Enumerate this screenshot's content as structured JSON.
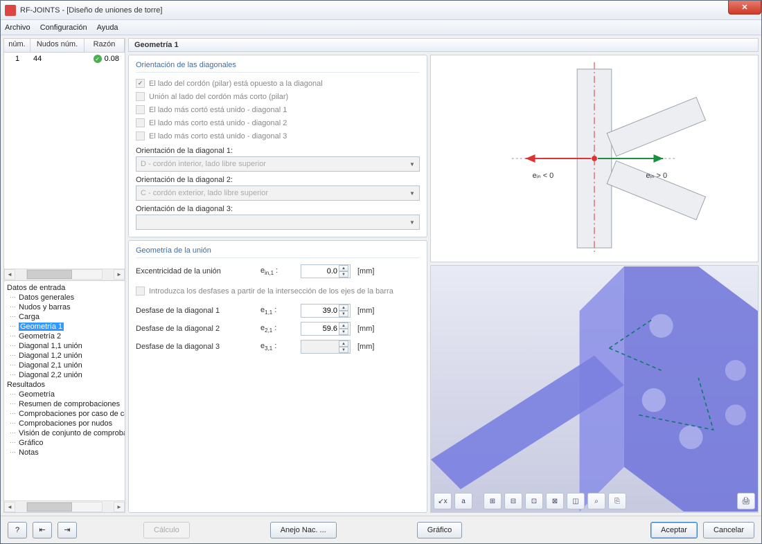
{
  "window": {
    "title": "RF-JOINTS - [Diseño de uniones de torre]",
    "close": "✕"
  },
  "menu": {
    "file": "Archivo",
    "config": "Configuración",
    "help": "Ayuda"
  },
  "grid": {
    "headers": {
      "num": "núm.",
      "nodes": "Nudos núm.",
      "reason": "Razón"
    },
    "row": {
      "num": "1",
      "nodes": "44",
      "reason": "0.08"
    }
  },
  "tree": {
    "input_title": "Datos de entrada",
    "input_items": [
      "Datos generales",
      "Nudos y barras",
      "Carga",
      "Geometría 1",
      "Geometría 2",
      "Diagonal 1,1 unión",
      "Diagonal 1,2 unión",
      "Diagonal 2,1 unión",
      "Diagonal 2,2 unión"
    ],
    "selected_index": 3,
    "results_title": "Resultados",
    "results_items": [
      "Geometría",
      "Resumen de comprobaciones",
      "Comprobaciones por caso de ca",
      "Comprobaciones por nudos",
      "Visión de conjunto de comproba",
      "Gráfico",
      "Notas"
    ]
  },
  "panel": {
    "title": "Geometría 1",
    "orient_group": "Orientación de las diagonales",
    "chk1": "El lado del cordón (pilar) está opuesto a la diagonal",
    "chk2": "Unión al lado del cordón más corto (pilar)",
    "chk3": "El lado más cortó está unido - diagonal 1",
    "chk4": "El lado más corto está unido - diagonal 2",
    "chk5": "El lado más corto está unido - diagonal 3",
    "orient1_label": "Orientación de la diagonal 1:",
    "orient1_value": "D - cordón interior, lado libre superior",
    "orient2_label": "Orientación de la diagonal 2:",
    "orient2_value": "C - cordón exterior, lado libre superior",
    "orient3_label": "Orientación de la diagonal 3:",
    "orient3_value": "",
    "geom_group": "Geometría de la unión",
    "ecc_label": "Excentricidad de la unión",
    "ecc_sym": "e",
    "ecc_sub": "in,1",
    "ecc_val": "0.0",
    "unit_mm": "[mm]",
    "chk_offsets": "Introduzca los desfases a partir de la intersección de los ejes de la barra",
    "off1_label": "Desfase de la diagonal 1",
    "off1_sym": "e",
    "off1_sub": "1,1",
    "off1_val": "39.0",
    "off2_label": "Desfase de la diagonal 2",
    "off2_sym": "e",
    "off2_sub": "2,1",
    "off2_val": "59.6",
    "off3_label": "Desfase de la diagonal 3",
    "off3_sym": "e",
    "off3_sub": "3,1",
    "off3_val": ""
  },
  "diagram": {
    "left_label": "eᵢₙ < 0",
    "right_label": "eᵢₙ > 0"
  },
  "footer": {
    "calc": "Cálculo",
    "annex": "Anejo Nac. ...",
    "graphic": "Gráfico",
    "ok": "Aceptar",
    "cancel": "Cancelar"
  }
}
